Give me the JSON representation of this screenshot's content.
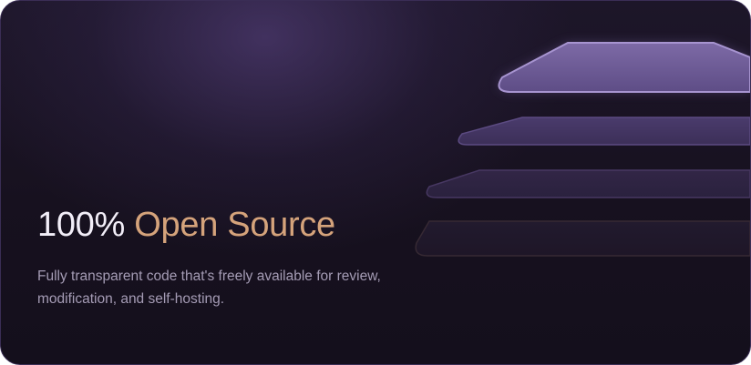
{
  "card": {
    "headline_plain": "100%",
    "headline_accent": "Open Source",
    "description": "Fully transparent code that's freely available for review, modification, and self-hosting."
  },
  "colors": {
    "background": "#17111f",
    "headline": "#f2eef8",
    "accent": "#d5a37b",
    "description": "#a59cb5",
    "layer_top": "#6d5a94"
  },
  "illustration": {
    "icon": "stacked-layers-illustration",
    "layers": 4
  }
}
